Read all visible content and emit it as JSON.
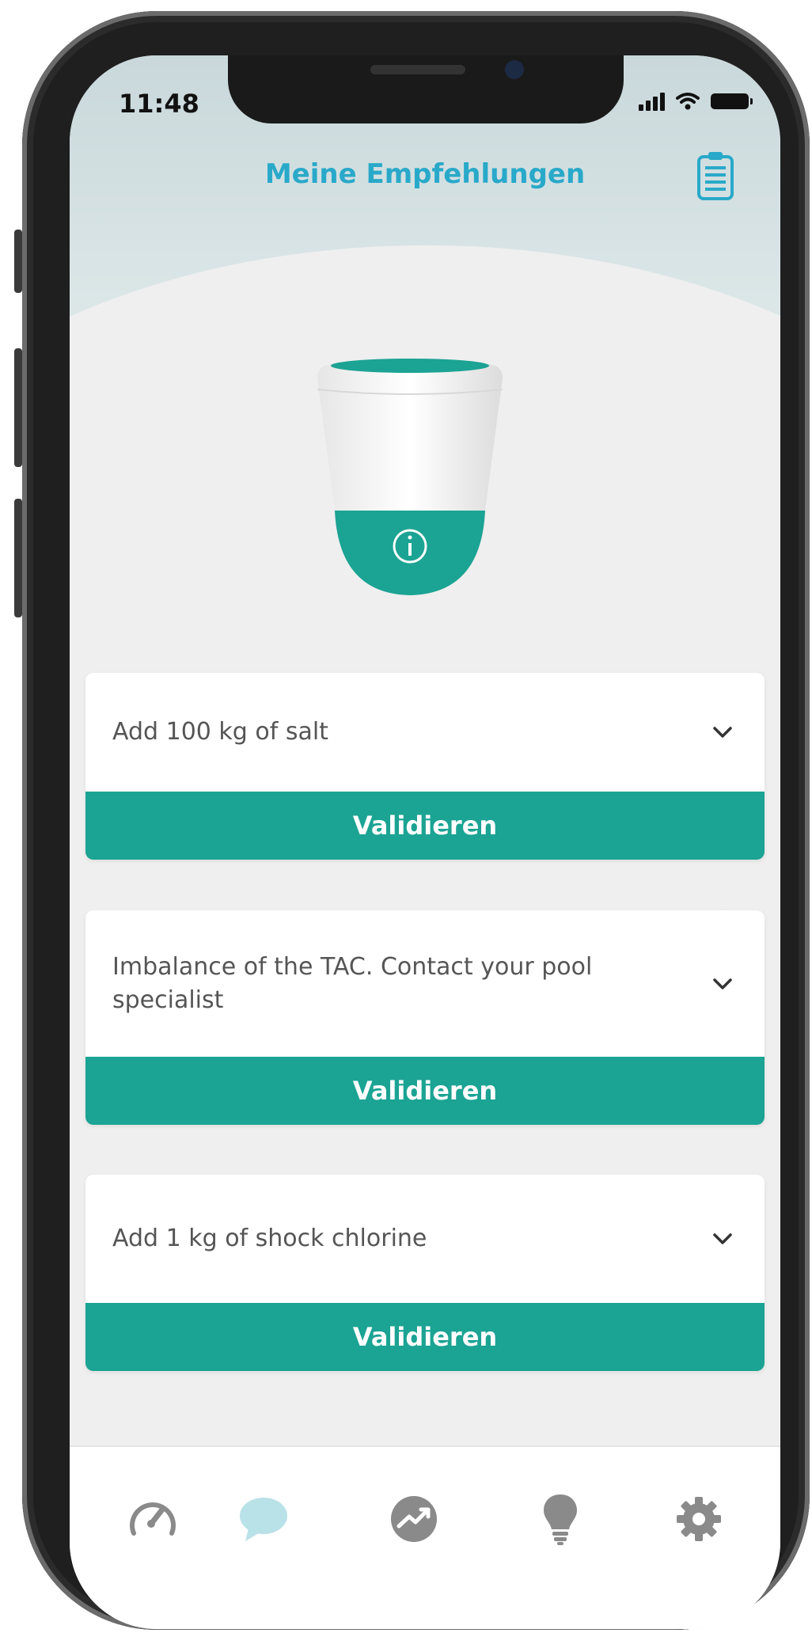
{
  "status_bar": {
    "time": "11:48"
  },
  "header": {
    "title": "Meine Empfehlungen"
  },
  "recommendations": [
    {
      "text": "Add 100 kg of salt",
      "button": "Validieren"
    },
    {
      "text": "Imbalance of the TAC. Contact your pool specialist",
      "button": "Validieren"
    },
    {
      "text": "Add 1 kg of shock chlorine",
      "button": "Validieren"
    }
  ],
  "nav": {
    "items": [
      {
        "icon": "gauge-icon",
        "active": false
      },
      {
        "icon": "chat-bubble-icon",
        "active": true
      },
      {
        "icon": "trend-icon",
        "active": false
      },
      {
        "icon": "lightbulb-icon",
        "active": false
      },
      {
        "icon": "gear-icon",
        "active": false
      }
    ]
  },
  "colors": {
    "accent": "#1ba393",
    "title": "#29a9c9",
    "nav_active": "#b9e1e8",
    "nav_inactive": "#8a8a8a"
  }
}
